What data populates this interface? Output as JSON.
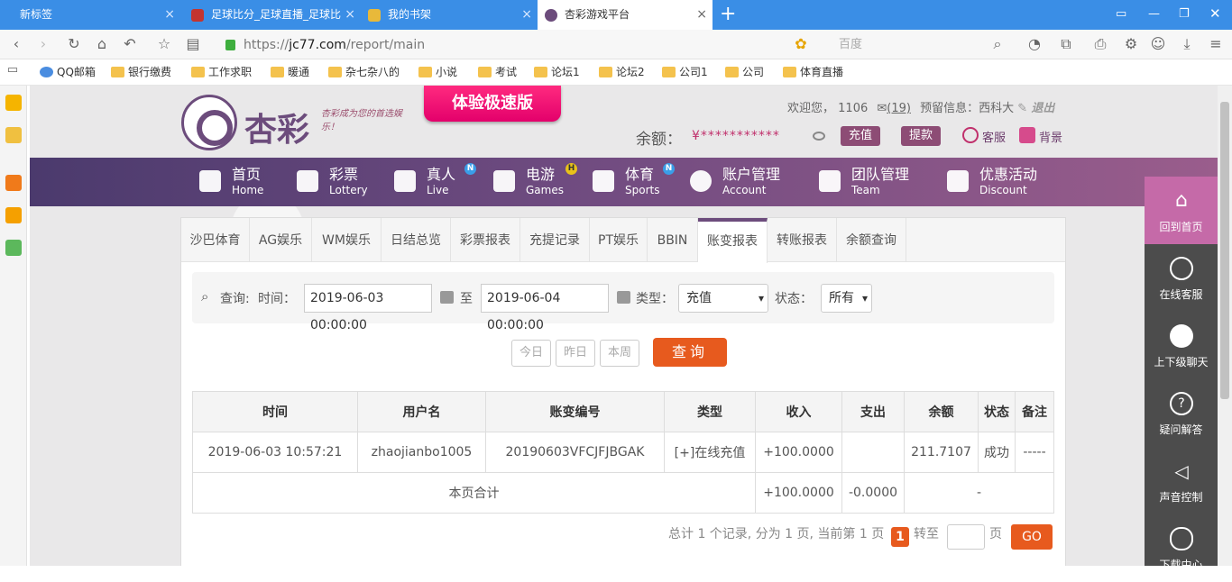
{
  "browser": {
    "tabs": [
      {
        "label": "新标签"
      },
      {
        "label": "足球比分_足球直播_足球比"
      },
      {
        "label": "我的书架"
      },
      {
        "label": "杏彩游戏平台"
      }
    ],
    "url_prefix": "https://",
    "url_host": "jc77.com",
    "url_path": "/report/main",
    "search_placeholder": "百度",
    "bookmarks": [
      "QQ邮箱",
      "银行缴费",
      "工作求职",
      "暖通",
      "杂七杂八的",
      "小说",
      "考试",
      "论坛1",
      "论坛2",
      "公司1",
      "公司",
      "体育直播"
    ]
  },
  "site": {
    "logo_text": "杏彩",
    "slogan": "杏彩成为您的首选娱乐！",
    "promo_label": "体验极速版",
    "welcome_prefix": "欢迎您，",
    "username": "1106",
    "messages": "(19)",
    "reserve_label": "预留信息：",
    "reserve_value": "西科大",
    "logout": "退出",
    "balance_label": "余额：",
    "balance_value": "¥***********",
    "recharge": "充值",
    "withdraw": "提款",
    "service": "客服",
    "background": "背景"
  },
  "nav": [
    {
      "zh": "首页",
      "en": "Home"
    },
    {
      "zh": "彩票",
      "en": "Lottery"
    },
    {
      "zh": "真人",
      "en": "Live",
      "badge": "N"
    },
    {
      "zh": "电游",
      "en": "Games",
      "badge": "H"
    },
    {
      "zh": "体育",
      "en": "Sports",
      "badge": "N"
    },
    {
      "zh": "账户管理",
      "en": "Account"
    },
    {
      "zh": "团队管理",
      "en": "Team"
    },
    {
      "zh": "优惠活动",
      "en": "Discount"
    }
  ],
  "subtabs": [
    "沙巴体育",
    "AG娱乐",
    "WM娱乐",
    "日结总览",
    "彩票报表",
    "充提记录",
    "PT娱乐",
    "BBIN",
    "账变报表",
    "转账报表",
    "余额查询"
  ],
  "filter": {
    "query_label": "查询:",
    "time_label": "时间：",
    "start": "2019-06-03 00:00:00",
    "to": "至",
    "end": "2019-06-04 00:00:00",
    "type_label": "类型：",
    "type_value": "充值",
    "status_label": "状态：",
    "status_value": "所有",
    "today": "今日",
    "yesterday": "昨日",
    "this_week": "本周",
    "search": "查询"
  },
  "table": {
    "headers": [
      "时间",
      "用户名",
      "账变编号",
      "类型",
      "收入",
      "支出",
      "余额",
      "状态",
      "备注"
    ],
    "row": {
      "time": "2019-06-03 10:57:21",
      "user": "zhaojianbo1005",
      "id": "20190603VFCJFJBGAK",
      "type": "[+]在线充值",
      "income": "+100.0000",
      "expense": "",
      "balance": "211.7107",
      "status": "成功",
      "note": "-----"
    },
    "total": {
      "label": "本页合计",
      "income": "+100.0000",
      "expense": "-0.0000",
      "balance": "-"
    }
  },
  "pager": {
    "summary": "总计 1 个记录, 分为 1 页, 当前第 1 页",
    "current": "1",
    "goto": "转至",
    "page_unit": "页",
    "go": "GO"
  },
  "rightbar": [
    "回到首页",
    "在线客服",
    "上下级聊天",
    "疑问解答",
    "声音控制",
    "下载中心"
  ]
}
